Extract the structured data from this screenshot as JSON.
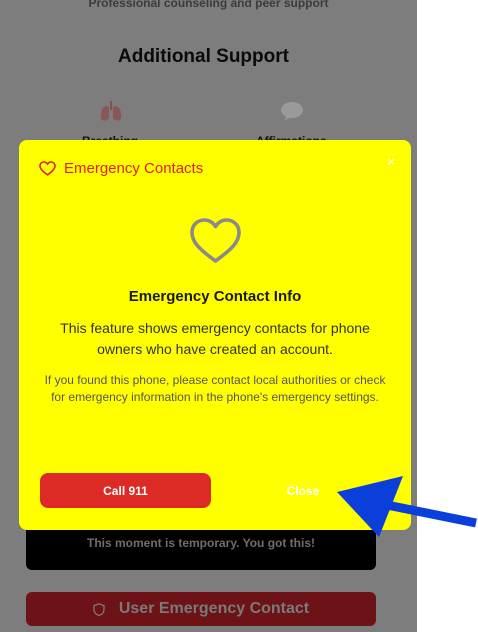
{
  "background": {
    "subtitle": "Professional counseling and peer support",
    "section_title": "Additional Support",
    "cards": [
      {
        "icon": "lungs-icon",
        "label": "Breathing"
      },
      {
        "icon": "speech-bubble-icon",
        "label": "Affirmations"
      }
    ],
    "banner_text": "This moment is temporary. You got this!",
    "user_emergency_label": "User Emergency Contact",
    "user_emergency_icon": "shield-icon"
  },
  "modal": {
    "title": "Emergency Contacts",
    "title_icon": "heart-icon",
    "close_symbol": "×",
    "illustration_icon": "heart-outline-icon",
    "info_title": "Emergency Contact Info",
    "info_text": "This feature shows emergency contacts for phone owners who have created an account.",
    "info_small": "If you found this phone, please contact local authorities or check for emergency information in the phone's emergency settings.",
    "call_button": "Call 911",
    "close_button": "Close"
  },
  "colors": {
    "modal_bg": "#ffff00",
    "title_red": "#e0201f",
    "call_red": "#dd2a27",
    "overlay_gray": "#7d7d7d",
    "arrow_blue": "#0a3fdc"
  }
}
